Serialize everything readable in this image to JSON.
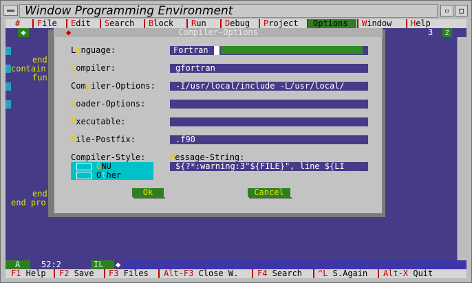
{
  "window": {
    "title": "Window Programming Environment",
    "min_glyph": "▫",
    "max_glyph": "□"
  },
  "menubar": {
    "items": [
      {
        "label": "#"
      },
      {
        "hot": "F",
        "rest": "ile"
      },
      {
        "hot": "E",
        "rest": "dit"
      },
      {
        "hot": "S",
        "rest": "earch"
      },
      {
        "hot": "B",
        "rest": "lock"
      },
      {
        "hot": "R",
        "rest": "un"
      },
      {
        "hot": "D",
        "rest": "ebug"
      },
      {
        "hot": "P",
        "rest": "roject"
      },
      {
        "hot": "O",
        "rest": "ptions"
      },
      {
        "hot": "W",
        "rest": "indow"
      },
      {
        "hot": "H",
        "rest": "elp"
      }
    ],
    "active": "Options"
  },
  "editor": {
    "tab_indicator": "◆",
    "tab_number": "3",
    "tab_z": "z",
    "code_lines": [
      "end",
      "contain",
      "fun",
      "end",
      "end pro"
    ]
  },
  "dialog": {
    "title": "Compiler-Options",
    "close_glyph": "◆",
    "labels": {
      "language": {
        "pre": "L",
        "hot": "a",
        "post": "nguage:"
      },
      "compiler": {
        "pre": "",
        "hot": "C",
        "post": "ompiler:"
      },
      "compiler_options": {
        "pre": "Com",
        "hot": "p",
        "post": "iler-Options:"
      },
      "loader_options": {
        "pre": "",
        "hot": "L",
        "post": "oader-Options:"
      },
      "executable": {
        "pre": "",
        "hot": "E",
        "post": "xecutable:"
      },
      "file_postfix": {
        "pre": "",
        "hot": "F",
        "post": "ile-Postfix:"
      },
      "compiler_style": "Compiler-Style:",
      "message_string": {
        "pre": "",
        "hot": "M",
        "post": "essage-String:"
      }
    },
    "values": {
      "language": "Fortran",
      "compiler": "gfortran",
      "compiler_options": "-I/usr/local/include -L/usr/local/",
      "loader_options": "",
      "executable": "",
      "file_postfix": ".f90",
      "message_string": "${?*:warning:3\"${FILE}\", line ${LI"
    },
    "radio": [
      {
        "hot": "G",
        "rest": "NU"
      },
      {
        "pre": "O",
        "hot": "t",
        "rest": "her"
      }
    ],
    "buttons": {
      "ok": "Ok",
      "cancel": "Cancel"
    }
  },
  "status": {
    "mode": "A",
    "position": "52:2",
    "il": "IL",
    "mark": "◆"
  },
  "keybar": [
    {
      "key": "F1",
      "label": " Help"
    },
    {
      "key": "F2",
      "label": " Save"
    },
    {
      "key": "F3",
      "label": " Files"
    },
    {
      "key": "Alt-F3",
      "label": " Close W."
    },
    {
      "key": "F4",
      "label": " Search"
    },
    {
      "key": "^L",
      "label": " S.Again"
    },
    {
      "key": "Alt-X",
      "label": " Quit"
    }
  ]
}
